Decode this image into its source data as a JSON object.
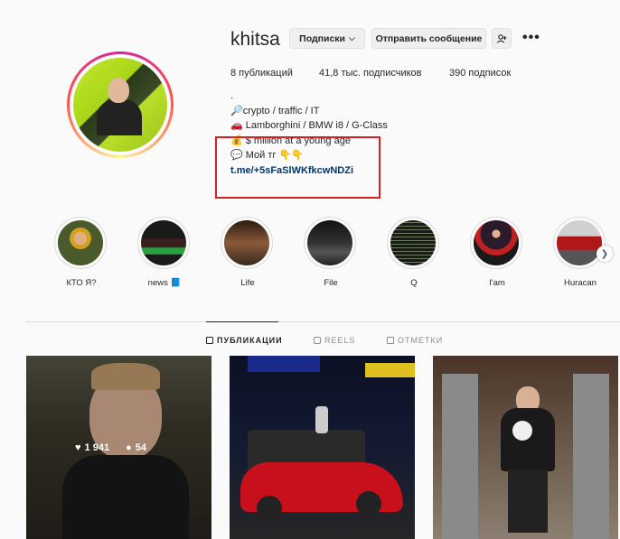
{
  "profile": {
    "username": "khitsa",
    "follow_label": "Подписки",
    "message_label": "Отправить сообщение",
    "posts": "8 публикаций",
    "followers": "41,8 тыс. подписчиков",
    "following": "390 подписок"
  },
  "bio": {
    "line0": ".",
    "line1": "🔎crypto / traffic / IT",
    "line2": "🚗 Lamborghini / BMW i8 / G-Class",
    "line3": "💰 $ million at a young age",
    "line4": "💬 Мой тг 👇👇",
    "link": "t.me/+5sFaSlWKfkcwNDZi"
  },
  "highlights": [
    {
      "label": "КТО Я?",
      "color": "#4a5a2a"
    },
    {
      "label": "news 📘",
      "color": "#3a1f1f"
    },
    {
      "label": "Life",
      "color": "#5a3a2a"
    },
    {
      "label": "File",
      "color": "#2a2a2a"
    },
    {
      "label": "Q",
      "color": "#1f2f1f"
    },
    {
      "label": "I'am",
      "color": "#2a1a2a"
    },
    {
      "label": "Huracan",
      "color": "#8a1a1a"
    }
  ],
  "tabs": {
    "posts": "ПУБЛИКАЦИИ",
    "reels": "REELS",
    "tagged": "ОТМЕТКИ"
  },
  "post_stats": {
    "likes": "1 941",
    "comments": "54"
  },
  "colors": {
    "link": "#00376b",
    "highlight_border": "#d92020"
  }
}
